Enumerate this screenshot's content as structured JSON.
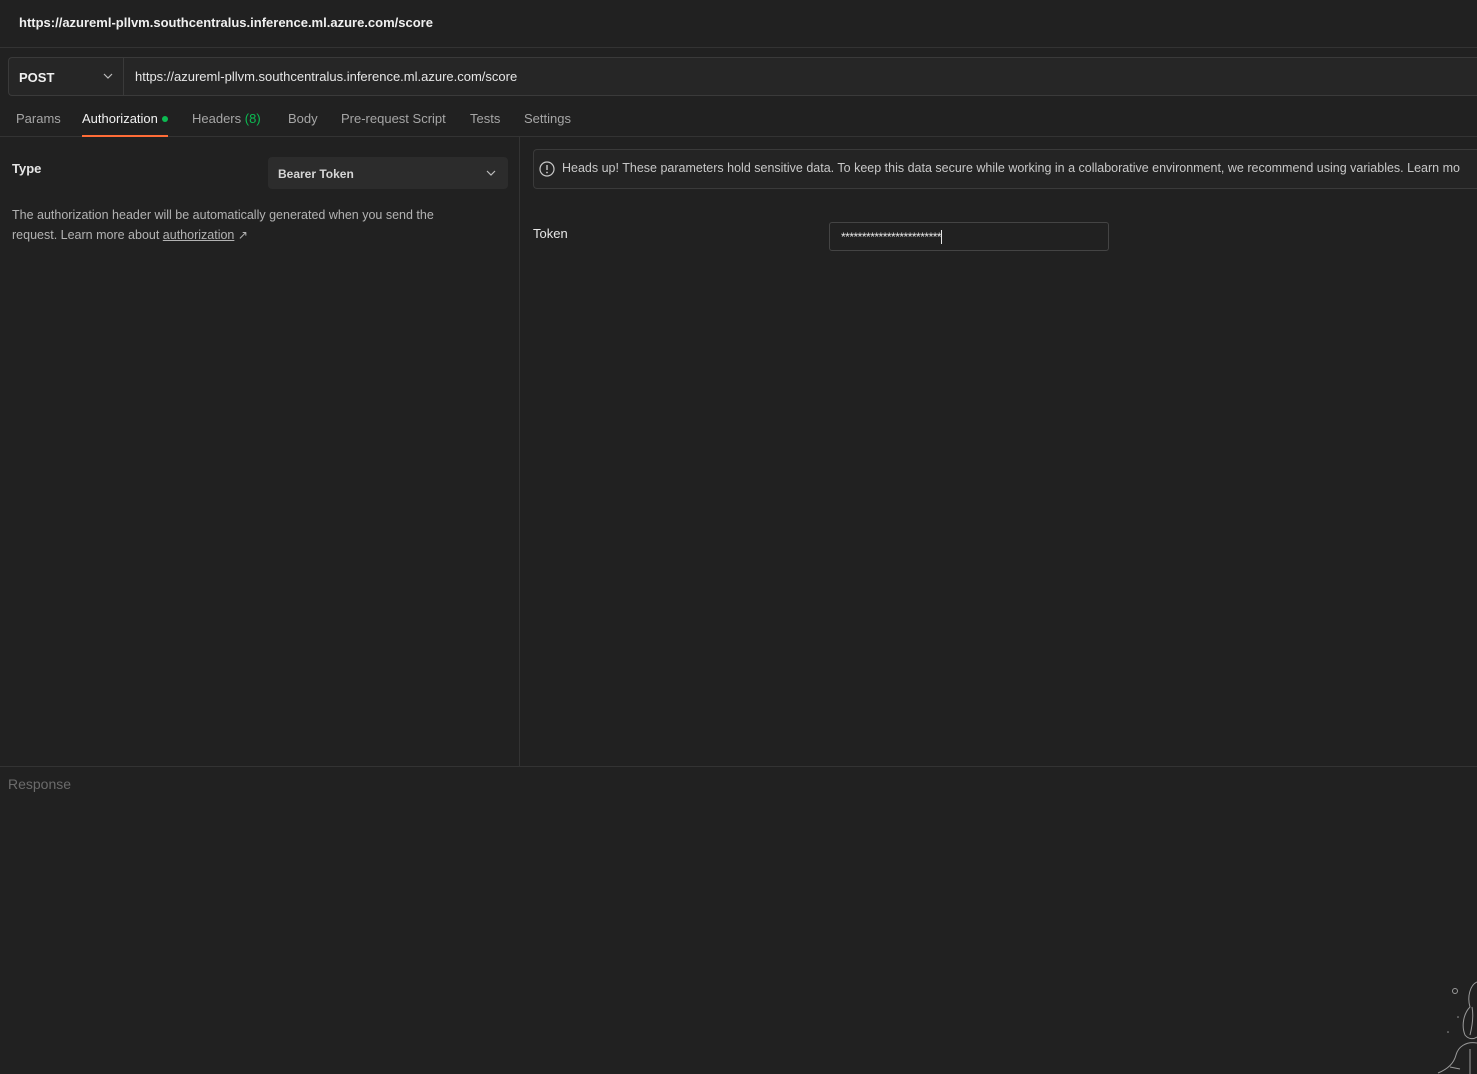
{
  "window": {
    "title": "https://azureml-pllvm.southcentralus.inference.ml.azure.com/score"
  },
  "request": {
    "method": "POST",
    "url": "https://azureml-pllvm.southcentralus.inference.ml.azure.com/score"
  },
  "tabs": [
    {
      "label": "Params",
      "active": false
    },
    {
      "label": "Authorization",
      "active": true,
      "indicator": "green-dot"
    },
    {
      "label": "Headers",
      "count": "(8)",
      "active": false
    },
    {
      "label": "Body",
      "active": false
    },
    {
      "label": "Pre-request Script",
      "active": false
    },
    {
      "label": "Tests",
      "active": false
    },
    {
      "label": "Settings",
      "active": false
    }
  ],
  "auth": {
    "type_label": "Type",
    "type_value": "Bearer Token",
    "description_prefix": "The authorization header will be automatically generated when you send the request. Learn more about ",
    "description_link": "authorization",
    "description_arrow": "↗",
    "alert": "Heads up! These parameters hold sensitive data. To keep this data secure while working in a collaborative environment, we recommend using variables. Learn mo",
    "token_label": "Token",
    "token_value": "************************"
  },
  "response": {
    "label": "Response"
  },
  "colors": {
    "background": "#212121",
    "accent": "#ff6c37",
    "success": "#0cbb52"
  }
}
